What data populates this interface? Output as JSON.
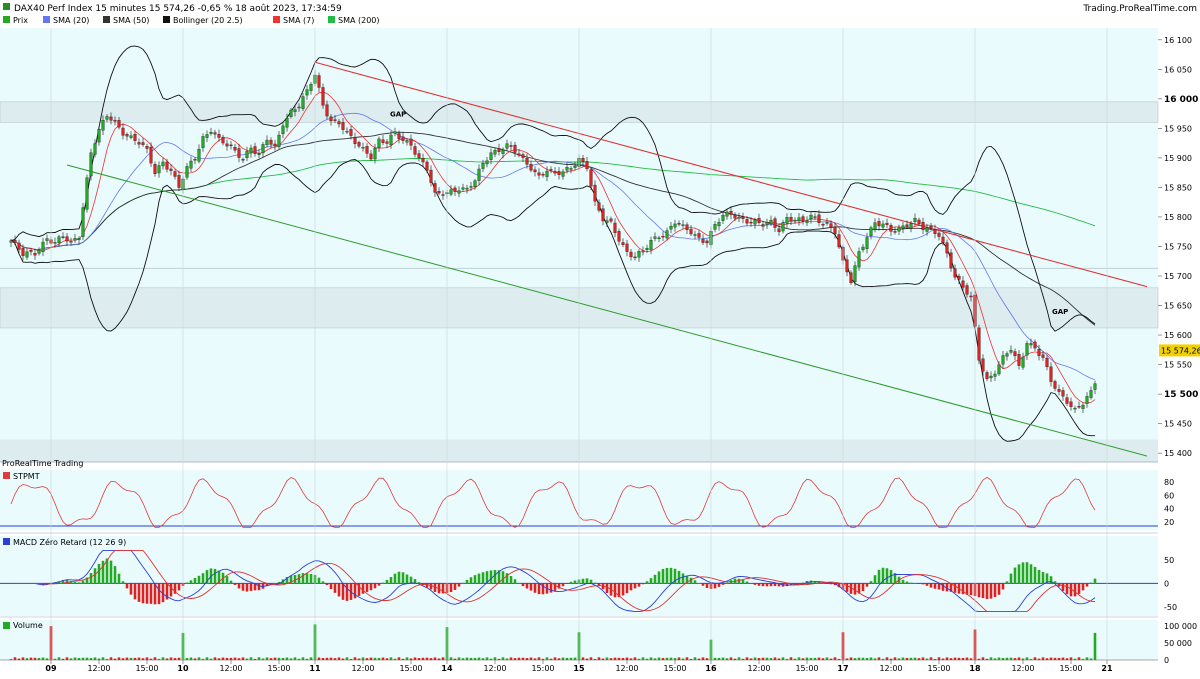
{
  "header": {
    "title": "DAX40 Perf Index 15 minutes 15 574,26 -0,65 % 18 août 2023, 17:34:59",
    "brand": "Trading.ProRealTime.com"
  },
  "legend": [
    {
      "label": "Prix",
      "color": "#22aa22"
    },
    {
      "label": "SMA (20)",
      "color": "#6677ee"
    },
    {
      "label": "SMA (50)",
      "color": "#333333"
    },
    {
      "label": "Bollinger (20 2.5)",
      "color": "#111111"
    },
    {
      "label": "SMA (7)",
      "color": "#ee3333"
    },
    {
      "label": "SMA (200)",
      "color": "#22bb44"
    }
  ],
  "colors": {
    "background": "#eafbfd",
    "up": "#22aa22",
    "down": "#dd2222",
    "sma20": "#6677ee",
    "sma50": "#333333",
    "sma7": "#ee3333",
    "sma200": "#22bb44",
    "bollinger": "#111111",
    "resistance": "#e03030",
    "support": "#2a9a2a",
    "price_badge": "#f2d100"
  },
  "chart_data": [
    {
      "type": "candlestick",
      "title": "DAX40 Perf Index 15 minutes",
      "last_price_label": "15 574,26",
      "y_ticks": [
        "16 100",
        "16 050",
        "16 000",
        "15 950",
        "15 900",
        "15 850",
        "15 800",
        "15 750",
        "15 700",
        "15 650",
        "15 600",
        "15 550",
        "15 500",
        "15 450",
        "15 400"
      ],
      "y_tick_values": [
        16100,
        16050,
        16000,
        15950,
        15900,
        15850,
        15800,
        15750,
        15700,
        15650,
        15600,
        15550,
        15500,
        15450,
        15400
      ],
      "ylim": [
        15385,
        16120
      ],
      "x_labels": [
        "15:00",
        "09",
        "12:00",
        "15:00",
        "10",
        "12:00",
        "15:00",
        "11",
        "12:00",
        "15:00",
        "14",
        "12:00",
        "15:00",
        "15",
        "12:00",
        "15:00",
        "16",
        "12:00",
        "15:00",
        "17",
        "12:00",
        "15:00",
        "18",
        "12:00",
        "15:00",
        "21"
      ],
      "x_label_bars": [
        -3,
        10,
        22,
        34,
        43,
        55,
        67,
        76,
        88,
        100,
        109,
        121,
        133,
        142,
        154,
        166,
        175,
        187,
        199,
        208,
        220,
        232,
        241,
        253,
        265,
        274
      ],
      "bar_count": 272,
      "annotations": [
        {
          "text": "GAP",
          "band": [
            15960,
            15995
          ]
        },
        {
          "text": "GAP",
          "band": [
            15612,
            15680
          ]
        }
      ],
      "gap_bands": [
        [
          15960,
          15995
        ],
        [
          15612,
          15680
        ]
      ],
      "reference_line": 15713,
      "reference_line_2": 15423,
      "close_anchors": [
        [
          0,
          15760
        ],
        [
          3,
          15735
        ],
        [
          6,
          15740
        ],
        [
          9,
          15765
        ],
        [
          11,
          15755
        ],
        [
          13,
          15765
        ],
        [
          15,
          15755
        ],
        [
          17,
          15770
        ],
        [
          18,
          15820
        ],
        [
          20,
          15910
        ],
        [
          22,
          15945
        ],
        [
          24,
          15970
        ],
        [
          26,
          15960
        ],
        [
          28,
          15945
        ],
        [
          30,
          15935
        ],
        [
          32,
          15925
        ],
        [
          34,
          15910
        ],
        [
          36,
          15875
        ],
        [
          38,
          15895
        ],
        [
          40,
          15880
        ],
        [
          42,
          15850
        ],
        [
          44,
          15880
        ],
        [
          46,
          15900
        ],
        [
          48,
          15935
        ],
        [
          50,
          15950
        ],
        [
          52,
          15930
        ],
        [
          54,
          15920
        ],
        [
          56,
          15910
        ],
        [
          58,
          15900
        ],
        [
          60,
          15920
        ],
        [
          62,
          15905
        ],
        [
          64,
          15930
        ],
        [
          66,
          15915
        ],
        [
          68,
          15960
        ],
        [
          70,
          15980
        ],
        [
          72,
          15990
        ],
        [
          74,
          16010
        ],
        [
          76,
          16040
        ],
        [
          78,
          15990
        ],
        [
          80,
          15965
        ],
        [
          82,
          15960
        ],
        [
          84,
          15940
        ],
        [
          86,
          15925
        ],
        [
          88,
          15915
        ],
        [
          90,
          15905
        ],
        [
          92,
          15930
        ],
        [
          94,
          15925
        ],
        [
          96,
          15940
        ],
        [
          98,
          15930
        ],
        [
          100,
          15925
        ],
        [
          102,
          15900
        ],
        [
          104,
          15880
        ],
        [
          106,
          15835
        ],
        [
          108,
          15840
        ],
        [
          110,
          15845
        ],
        [
          112,
          15850
        ],
        [
          114,
          15845
        ],
        [
          116,
          15860
        ],
        [
          118,
          15890
        ],
        [
          120,
          15910
        ],
        [
          122,
          15915
        ],
        [
          124,
          15920
        ],
        [
          126,
          15910
        ],
        [
          128,
          15895
        ],
        [
          130,
          15885
        ],
        [
          132,
          15870
        ],
        [
          134,
          15880
        ],
        [
          136,
          15870
        ],
        [
          138,
          15875
        ],
        [
          140,
          15885
        ],
        [
          142,
          15900
        ],
        [
          144,
          15885
        ],
        [
          146,
          15820
        ],
        [
          148,
          15795
        ],
        [
          150,
          15790
        ],
        [
          152,
          15765
        ],
        [
          154,
          15740
        ],
        [
          156,
          15730
        ],
        [
          158,
          15740
        ],
        [
          160,
          15760
        ],
        [
          162,
          15770
        ],
        [
          164,
          15775
        ],
        [
          166,
          15790
        ],
        [
          168,
          15780
        ],
        [
          170,
          15775
        ],
        [
          172,
          15765
        ],
        [
          174,
          15760
        ],
        [
          176,
          15785
        ],
        [
          178,
          15800
        ],
        [
          180,
          15805
        ],
        [
          182,
          15800
        ],
        [
          184,
          15795
        ],
        [
          186,
          15790
        ],
        [
          188,
          15785
        ],
        [
          190,
          15790
        ],
        [
          192,
          15780
        ],
        [
          194,
          15800
        ],
        [
          196,
          15795
        ],
        [
          198,
          15790
        ],
        [
          200,
          15800
        ],
        [
          202,
          15795
        ],
        [
          204,
          15790
        ],
        [
          206,
          15775
        ],
        [
          208,
          15720
        ],
        [
          210,
          15690
        ],
        [
          212,
          15740
        ],
        [
          214,
          15770
        ],
        [
          216,
          15790
        ],
        [
          218,
          15785
        ],
        [
          220,
          15775
        ],
        [
          222,
          15780
        ],
        [
          224,
          15790
        ],
        [
          226,
          15795
        ],
        [
          228,
          15780
        ],
        [
          230,
          15775
        ],
        [
          232,
          15770
        ],
        [
          234,
          15740
        ],
        [
          236,
          15700
        ],
        [
          238,
          15680
        ],
        [
          240,
          15660
        ],
        [
          242,
          15560
        ],
        [
          244,
          15525
        ],
        [
          246,
          15540
        ],
        [
          248,
          15560
        ],
        [
          250,
          15575
        ],
        [
          252,
          15545
        ],
        [
          254,
          15590
        ],
        [
          256,
          15580
        ],
        [
          258,
          15560
        ],
        [
          260,
          15520
        ],
        [
          262,
          15500
        ],
        [
          264,
          15490
        ],
        [
          266,
          15475
        ],
        [
          268,
          15485
        ],
        [
          270,
          15500
        ],
        [
          272,
          15535
        ],
        [
          274,
          15590
        ],
        [
          276,
          15580
        ]
      ],
      "overlay_lines": [
        {
          "name": "resistance",
          "points": [
            [
              76,
              16062
            ],
            [
              284,
              15682
            ]
          ]
        },
        {
          "name": "support",
          "points": [
            [
              14,
              15888
            ],
            [
              284,
              15395
            ]
          ]
        }
      ]
    },
    {
      "type": "line",
      "title": "STPMT",
      "ylim": [
        8,
        98
      ],
      "y_ticks": [
        80,
        60,
        40,
        20
      ],
      "reference_line": 14,
      "series": [
        {
          "name": "STPMT",
          "color": "#e03a3a"
        }
      ]
    },
    {
      "type": "bar+line",
      "title": "MACD Zéro Retard (12 26 9)",
      "ylim": [
        -65,
        75
      ],
      "y_ticks": [
        50,
        0,
        -50
      ],
      "series": [
        {
          "name": "MACD",
          "color": "#2b3fd6"
        },
        {
          "name": "Signal",
          "color": "#e03030"
        }
      ]
    },
    {
      "type": "bar",
      "title": "Volume",
      "ylim": [
        0,
        118000
      ],
      "y_ticks": [
        "100 000",
        "50 000",
        "0"
      ],
      "y_tick_values": [
        100000,
        50000,
        0
      ],
      "session_open_volumes": [
        {
          "bar": 10,
          "value": 100000
        },
        {
          "bar": 43,
          "value": 80000
        },
        {
          "bar": 76,
          "value": 105000
        },
        {
          "bar": 109,
          "value": 97000
        },
        {
          "bar": 142,
          "value": 82000
        },
        {
          "bar": 175,
          "value": 60000
        },
        {
          "bar": 208,
          "value": 82000
        },
        {
          "bar": 241,
          "value": 90000
        },
        {
          "bar": 274,
          "value": 80000
        }
      ]
    }
  ],
  "panels": {
    "provider_label": "ProRealTime Trading"
  }
}
